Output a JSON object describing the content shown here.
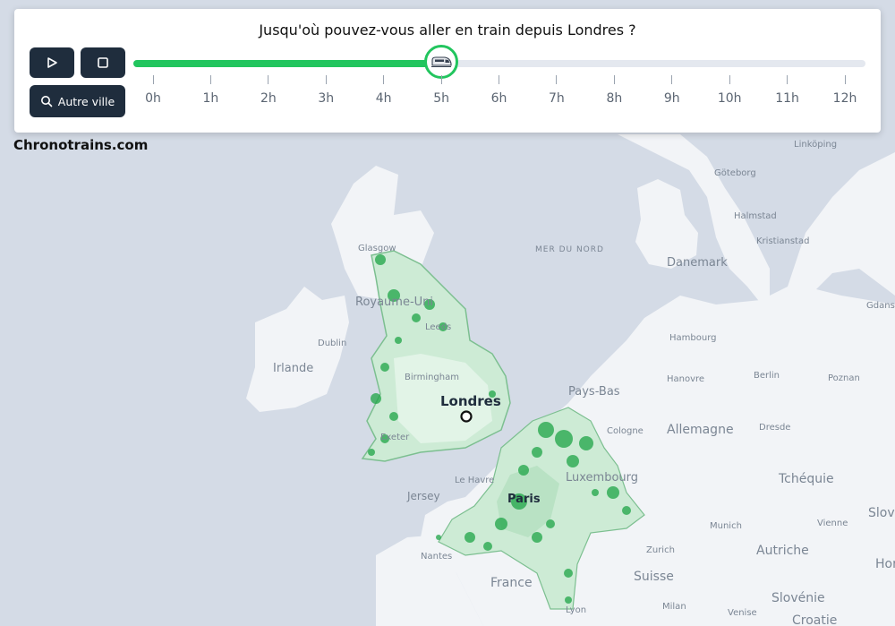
{
  "header": {
    "title": "Jusqu'où pouvez-vous aller en train depuis Londres ?",
    "play_icon": "play-icon",
    "stop_icon": "stop-icon",
    "city_button_label": "Autre ville",
    "city_button_icon": "search-icon"
  },
  "timeline": {
    "ticks": [
      "0h",
      "1h",
      "2h",
      "3h",
      "4h",
      "5h",
      "6h",
      "7h",
      "8h",
      "9h",
      "10h",
      "11h",
      "12h"
    ],
    "min_hours": 0,
    "max_hours": 12,
    "current_hours": 5,
    "handle_icon": "train-icon",
    "accent_color": "#22c55e"
  },
  "brand": "Chronotrains.com",
  "map": {
    "sea_label": "MER DU NORD",
    "origin_city": "Londres",
    "countries": [
      "Royaume-Uni",
      "Irlande",
      "Danemark",
      "Pays-Bas",
      "Allemagne",
      "France",
      "Luxembourg",
      "Tchéquie",
      "Autriche",
      "Suisse",
      "Slovénie",
      "Croatie",
      "Slova"
    ],
    "cities": [
      "Glasgow",
      "Leeds",
      "Birmingham",
      "Dublin",
      "Exeter",
      "Hambourg",
      "Hanovre",
      "Berlin",
      "Poznan",
      "Gdansk",
      "Cologne",
      "Dresde",
      "Munich",
      "Vienne",
      "Zurich",
      "Milan",
      "Venise",
      "Lyon",
      "Nantes",
      "Le Havre",
      "Paris",
      "Jersey",
      "Göteborg",
      "Linköping",
      "Halmstad",
      "Kristianstad",
      "Hor"
    ],
    "reach_color": "#22c55e"
  }
}
